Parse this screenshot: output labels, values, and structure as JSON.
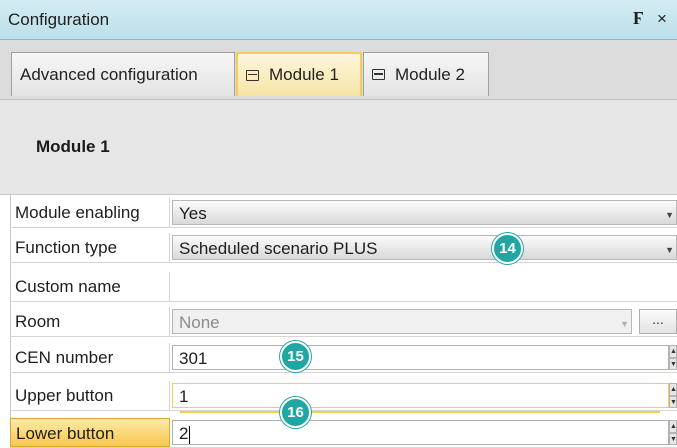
{
  "window": {
    "title": "Configuration",
    "pin_glyph": "q",
    "close_glyph": "×"
  },
  "tabs": [
    {
      "label": "Advanced configuration",
      "icon": "none",
      "active": false
    },
    {
      "label": "Module 1",
      "icon": "module-icon",
      "active": true
    },
    {
      "label": "Module 2",
      "icon": "module-icon",
      "active": false
    }
  ],
  "header": {
    "title": "Module 1"
  },
  "properties": [
    {
      "label": "Module enabling",
      "value": "Yes",
      "kind": "combo"
    },
    {
      "label": "Function type",
      "value": "Scheduled scenario PLUS",
      "kind": "combo"
    },
    {
      "label": "Custom name",
      "value": "",
      "kind": "text-plain"
    },
    {
      "label": "Room",
      "value": "None",
      "kind": "combo-disabled",
      "button": "..."
    },
    {
      "label": "CEN number",
      "value": "301",
      "kind": "spinner"
    },
    {
      "label": "Upper button",
      "value": "1",
      "kind": "spinner"
    },
    {
      "label": "Lower button",
      "value": "2",
      "kind": "spinner"
    }
  ],
  "callouts": [
    "14",
    "15",
    "16"
  ],
  "colors": {
    "accent_callout": "#20a6a3",
    "active_tab_border": "#f3cd55",
    "titlebar": "#c6e4ee"
  }
}
